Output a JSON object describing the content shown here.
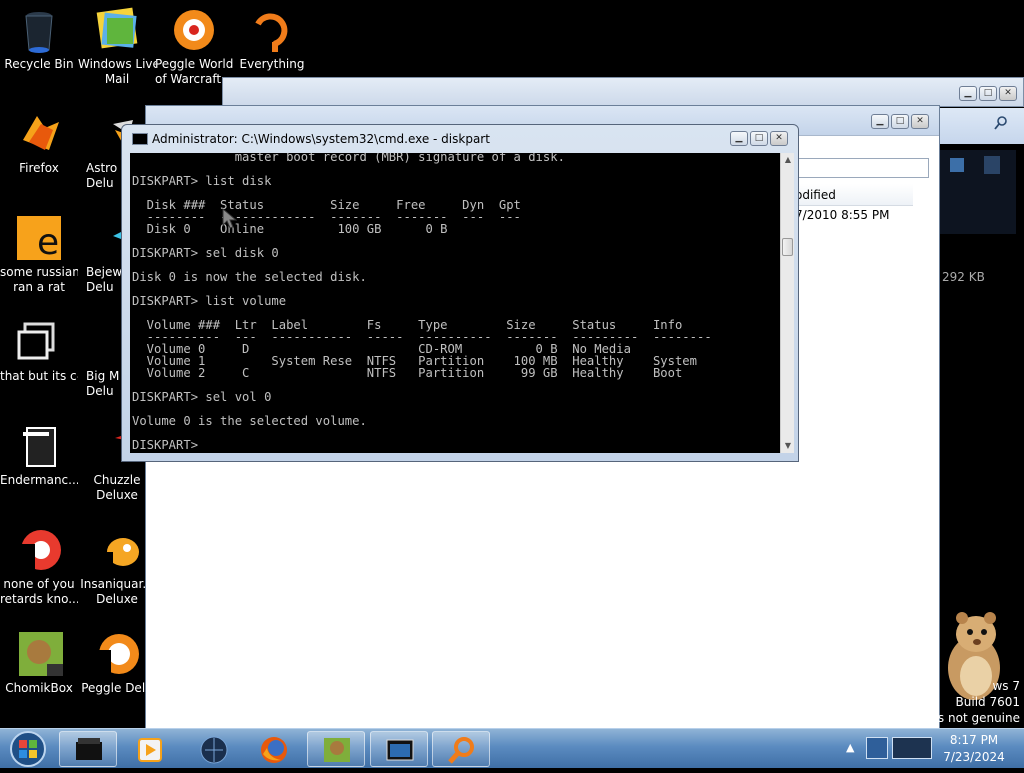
{
  "desktop": {
    "icons": [
      {
        "label_line1": "Recycle Bin",
        "label_line2": ""
      },
      {
        "label_line1": "Windows Live",
        "label_line2": "Mail"
      },
      {
        "label_line1": "Peggle World",
        "label_line2": "of Warcraft ..."
      },
      {
        "label_line1": "Everything",
        "label_line2": ""
      },
      {
        "label_line1": "Firefox",
        "label_line2": ""
      },
      {
        "label_line1": "Astro",
        "label_line2": "Delu"
      },
      {
        "label_line1": "some russian",
        "label_line2": "ran a rat"
      },
      {
        "label_line1": "Bejew",
        "label_line2": "Delu"
      },
      {
        "label_line1": "that but its c#",
        "label_line2": ""
      },
      {
        "label_line1": "Big M",
        "label_line2": "Delu"
      },
      {
        "label_line1": "Endermanc...",
        "label_line2": ""
      },
      {
        "label_line1": "Chuzzle",
        "label_line2": "Deluxe"
      },
      {
        "label_line1": "none of you",
        "label_line2": "retards kno..."
      },
      {
        "label_line1": "Insaniquar...",
        "label_line2": "Deluxe"
      },
      {
        "label_line1": "ChomikBox",
        "label_line2": ""
      },
      {
        "label_line1": "Peggle Delu",
        "label_line2": ""
      }
    ]
  },
  "explorer": {
    "column_header": "odified",
    "modified_value": "/7/2010 8:55 PM",
    "size_value": "292 KB"
  },
  "cmd": {
    "title": "Administrator: C:\\Windows\\system32\\cmd.exe - diskpart",
    "lines": [
      "              master boot record (MBR) signature of a disk.",
      "",
      "DISKPART> list disk",
      "",
      "  Disk ###  Status         Size     Free     Dyn  Gpt",
      "  --------  -------------  -------  -------  ---  ---",
      "  Disk 0    Online          100 GB      0 B",
      "",
      "DISKPART> sel disk 0",
      "",
      "Disk 0 is now the selected disk.",
      "",
      "DISKPART> list volume",
      "",
      "  Volume ###  Ltr  Label        Fs     Type        Size     Status     Info",
      "  ----------  ---  -----------  -----  ----------  -------  ---------  --------",
      "  Volume 0     D                       CD-ROM          0 B  No Media",
      "  Volume 1         System Rese  NTFS   Partition    100 MB  Healthy    System",
      "  Volume 2     C                NTFS   Partition     99 GB  Healthy    Boot",
      "",
      "DISKPART> sel vol 0",
      "",
      "Volume 0 is the selected volume.",
      "",
      "DISKPART>"
    ]
  },
  "watermark": {
    "line1": "ws 7",
    "line2": "Build 7601",
    "line3": "is not genuine"
  },
  "taskbar": {
    "time": "8:17 PM",
    "date": "7/23/2024"
  },
  "colors": {
    "taskbar": "#5b8bc0",
    "console_bg": "#000000",
    "console_fg": "#c0c0c0"
  }
}
